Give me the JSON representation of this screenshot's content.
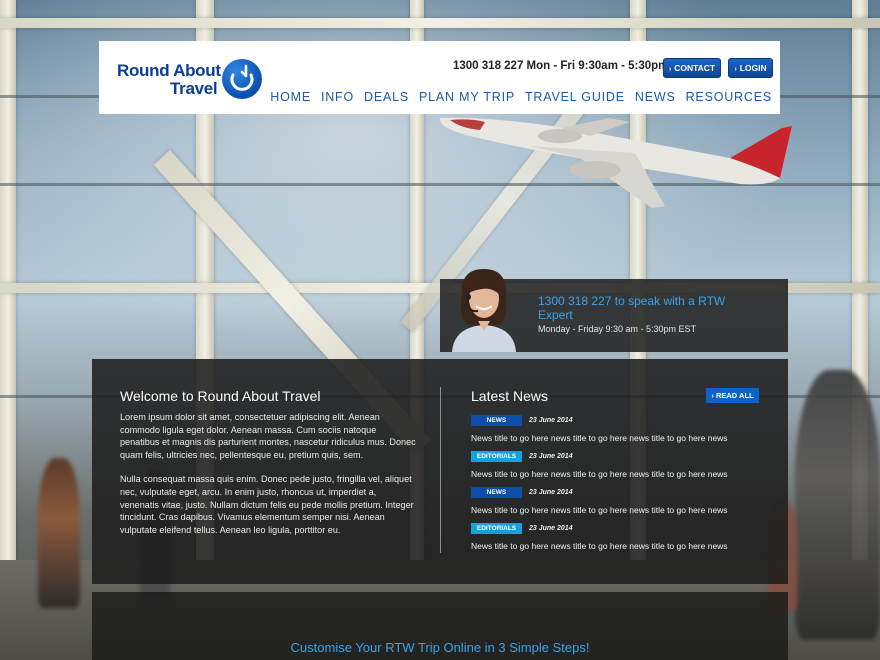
{
  "header": {
    "logo": {
      "line1": "Round About",
      "line2": "Travel"
    },
    "phone_hours": "1300 318 227 Mon - Fri 9:30am - 5:30pm",
    "contact_label": "CONTACT",
    "login_label": "LOGIN",
    "nav": [
      "HOME",
      "INFO",
      "DEALS",
      "PLAN MY TRIP",
      "TRAVEL GUIDE",
      "NEWS",
      "RESOURCES"
    ]
  },
  "expert": {
    "phone_line": "1300 318 227 to speak with a RTW Expert",
    "hours": "Monday - Friday 9:30 am - 5:30pm EST"
  },
  "welcome": {
    "title": "Welcome to Round About Travel",
    "paragraph1": "Lorem ipsum dolor sit amet, consectetuer adipiscing elit. Aenean commodo ligula eget dolor. Aenean massa. Cum sociis natoque penatibus et magnis dis parturient montes, nascetur ridiculus mus. Donec quam felis, ultricies nec, pellentesque eu, pretium quis, sem.",
    "paragraph2": "Nulla consequat massa quis enim. Donec pede justo, fringilla vel, aliquet nec, vulputate eget, arcu. In enim justo, rhoncus ut, imperdiet a, venenatis vitae, justo. Nullam dictum felis eu pede mollis pretium. Integer tincidunt. Cras dapibus. Vivamus elementum semper nisi. Aenean vulputate eleifend tellus. Aenean leo ligula, porttitor eu."
  },
  "news": {
    "title": "Latest News",
    "read_all": "READ ALL",
    "items": [
      {
        "badge": "NEWS",
        "date": "23 June 2014",
        "text": "News title to go here news title to go here news title to go here news"
      },
      {
        "badge": "EDITORIALS",
        "date": "23 June 2014",
        "text": "News title to go here news title to go here news title to go here news"
      },
      {
        "badge": "NEWS",
        "date": "23 June 2014",
        "text": "News title to go here news title to go here news title to go here news"
      },
      {
        "badge": "EDITORIALS",
        "date": "23 June 2014",
        "text": "News title to go here news title to go here news title to go here news"
      }
    ]
  },
  "lower": {
    "headline": "Customise Your RTW Trip Online in 3 Simple Steps!"
  },
  "colors": {
    "brand_blue": "#0b3f8f",
    "nav_blue": "#1d5aa8",
    "accent_cyan": "#3aa3e8",
    "badge_news": "#0d4ea8",
    "badge_editorials": "#18a0d9"
  }
}
